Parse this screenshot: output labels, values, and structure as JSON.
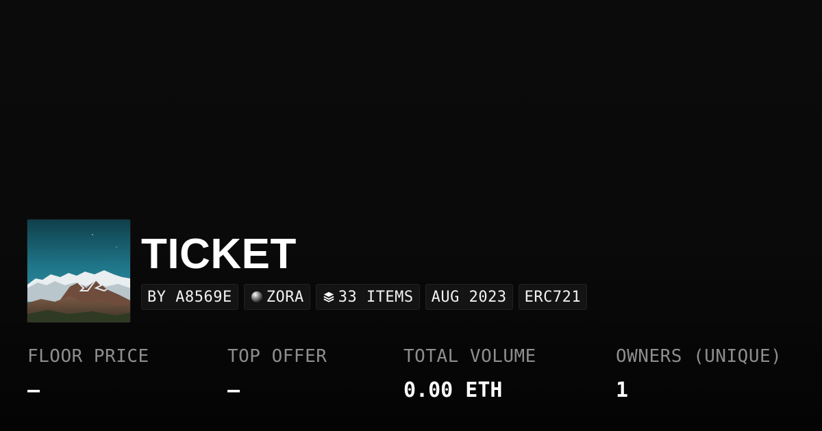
{
  "collection": {
    "title": "TICKET",
    "image_alt": "mountain landscape thumbnail"
  },
  "chips": [
    {
      "label": "BY A8569E",
      "icon": ""
    },
    {
      "label": "ZORA",
      "icon": "zora-orb-icon"
    },
    {
      "label": "33 ITEMS",
      "icon": "layers-icon"
    },
    {
      "label": "AUG 2023",
      "icon": ""
    },
    {
      "label": "ERC721",
      "icon": ""
    }
  ],
  "stats": {
    "floor_price": {
      "label": "FLOOR PRICE",
      "value": "–"
    },
    "top_offer": {
      "label": "TOP OFFER",
      "value": "–"
    },
    "total_volume": {
      "label": "TOTAL VOLUME",
      "value": "0.00 ETH"
    },
    "owners": {
      "label": "OWNERS (UNIQUE)",
      "value": "1"
    }
  },
  "colors": {
    "background": "#0a0a0a",
    "chip_background": "#141414",
    "label_gray": "#8e8e8e",
    "text": "#ffffff"
  }
}
